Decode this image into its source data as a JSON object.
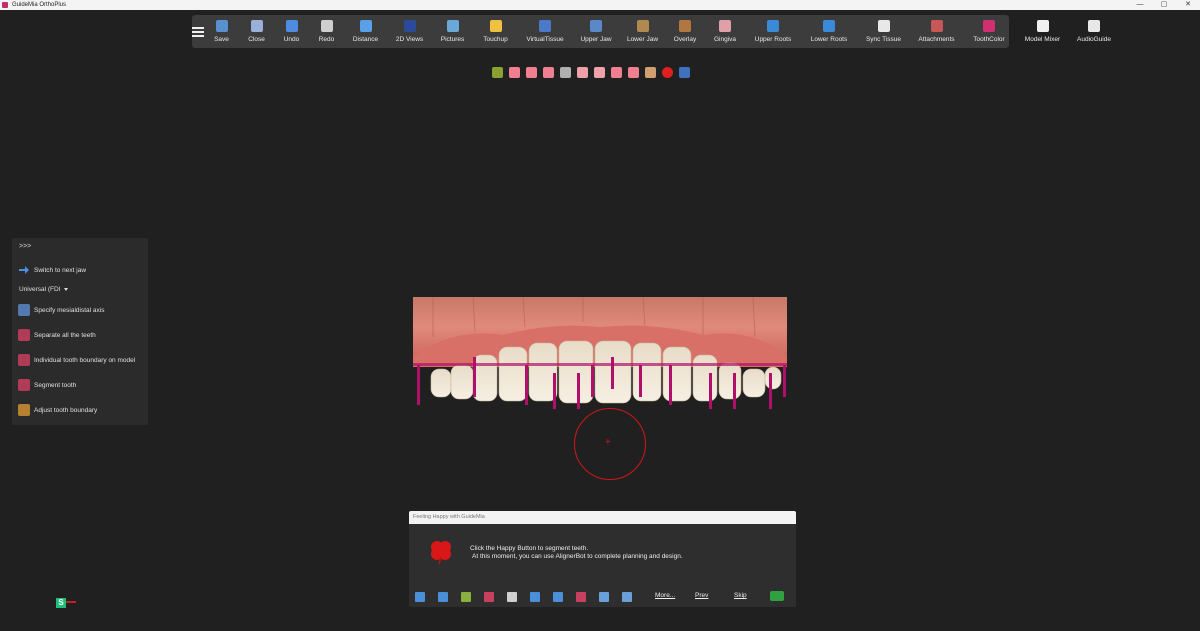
{
  "window": {
    "title": "GuideMia OrthoPlus",
    "controls": [
      "—",
      "▢",
      "✕"
    ]
  },
  "toolbar": {
    "buttons": [
      {
        "label": "Save",
        "icon": "save-icon",
        "color": "#5a8fd0"
      },
      {
        "label": "Close",
        "icon": "close-file-icon",
        "color": "#9ab0d8"
      },
      {
        "label": "Undo",
        "icon": "undo-icon",
        "color": "#4f8be0"
      },
      {
        "label": "Redo",
        "icon": "redo-icon",
        "color": "#cfcfcf"
      },
      {
        "label": "Distance",
        "icon": "ruler-icon",
        "color": "#5aa0e8"
      },
      {
        "label": "2D Views",
        "icon": "2d-views-icon",
        "color": "#2a4a9a"
      },
      {
        "label": "Pictures",
        "icon": "pictures-icon",
        "color": "#6aa8d8"
      },
      {
        "label": "Touchup",
        "icon": "touchup-icon",
        "color": "#f0c040"
      },
      {
        "label": "VirtualTissue",
        "icon": "virtual-tissue-icon",
        "color": "#4a7ac8"
      },
      {
        "label": "Upper Jaw",
        "icon": "upper-jaw-icon",
        "color": "#5a88c8"
      },
      {
        "label": "Lower Jaw",
        "icon": "lower-jaw-icon",
        "color": "#b08850"
      },
      {
        "label": "Overlay",
        "icon": "overlay-icon",
        "color": "#b07840"
      },
      {
        "label": "Gingiva",
        "icon": "gingiva-icon",
        "color": "#e0a0a8"
      },
      {
        "label": "Upper Roots",
        "icon": "upper-roots-icon",
        "color": "#3a8ad8"
      },
      {
        "label": "Lower Roots",
        "icon": "lower-roots-icon",
        "color": "#3a8ad8"
      },
      {
        "label": "Sync Tissue",
        "icon": "sync-tissue-icon",
        "color": "#e8e8e8"
      },
      {
        "label": "Attachments",
        "icon": "attachments-icon",
        "color": "#c85858"
      },
      {
        "label": "ToothColor",
        "icon": "tooth-color-icon",
        "color": "#d03070"
      },
      {
        "label": "Model Mixer",
        "icon": "cube-icon",
        "color": "#f0f0f0"
      },
      {
        "label": "AudioGuide",
        "icon": "microphone-icon",
        "color": "#e8e8e8"
      }
    ]
  },
  "view_icons": [
    {
      "name": "view-color-icon",
      "color": "#8aa030"
    },
    {
      "name": "view-left-icon",
      "color": "#f08090"
    },
    {
      "name": "view-right-icon",
      "color": "#f08090"
    },
    {
      "name": "view-front-icon",
      "color": "#f08090"
    },
    {
      "name": "view-back-icon",
      "color": "#b0b0b0"
    },
    {
      "name": "view-top-icon",
      "color": "#f0a0a8"
    },
    {
      "name": "view-bottom-icon",
      "color": "#f0a0a8"
    },
    {
      "name": "view-upper-arch-icon",
      "color": "#f08090"
    },
    {
      "name": "view-lower-arch-icon",
      "color": "#f08090"
    },
    {
      "name": "view-model-icon",
      "color": "#d0a070"
    },
    {
      "name": "view-red-dot-icon",
      "color": "#e02020"
    },
    {
      "name": "view-image-icon",
      "color": "#4070c0"
    }
  ],
  "left_panel": {
    "expand": ">>>",
    "switch_jaw": "Switch to next jaw",
    "numbering": "Universal (FDI",
    "items": [
      {
        "label": "Specify mesialdistal axis",
        "icon": "tooth-axis-icon",
        "color": "#5a88c8"
      },
      {
        "label": "Separate all the teeth",
        "icon": "separate-teeth-icon",
        "color": "#c84060"
      },
      {
        "label": "Individual tooth boundary on model",
        "icon": "tooth-boundary-icon",
        "color": "#c84060"
      },
      {
        "label": "Segment tooth",
        "icon": "segment-tooth-icon",
        "color": "#c84060"
      },
      {
        "label": "Adjust tooth boundary",
        "icon": "adjust-boundary-icon",
        "color": "#d09030"
      }
    ]
  },
  "gizmo": {
    "label": "S"
  },
  "dialog": {
    "title": "Feeling Happy with GuideMia",
    "line1": "Click the Happy Button to segment teeth.",
    "line2": "At this moment, you can use AlignerBot to complete planning and design.",
    "more": "More...",
    "prev": "Prev",
    "skip": "Skip",
    "bar_icons": [
      {
        "name": "menu-list-icon",
        "color": "#4a90d8"
      },
      {
        "name": "save-plan-icon",
        "color": "#4a90d8"
      },
      {
        "name": "tools-icon",
        "color": "#8ab040"
      },
      {
        "name": "segment-icon",
        "color": "#c84060"
      },
      {
        "name": "tooth-icon",
        "color": "#cfcfcf"
      },
      {
        "name": "search-tooth-icon",
        "color": "#4a90d8"
      },
      {
        "name": "monitor-icon",
        "color": "#4a90d8"
      },
      {
        "name": "attachment-tooth-icon",
        "color": "#c84060"
      },
      {
        "name": "bank-icon",
        "color": "#6aa0d8"
      },
      {
        "name": "export-icon",
        "color": "#6aa0d8"
      }
    ],
    "happy_icon_color": "#30a040"
  }
}
